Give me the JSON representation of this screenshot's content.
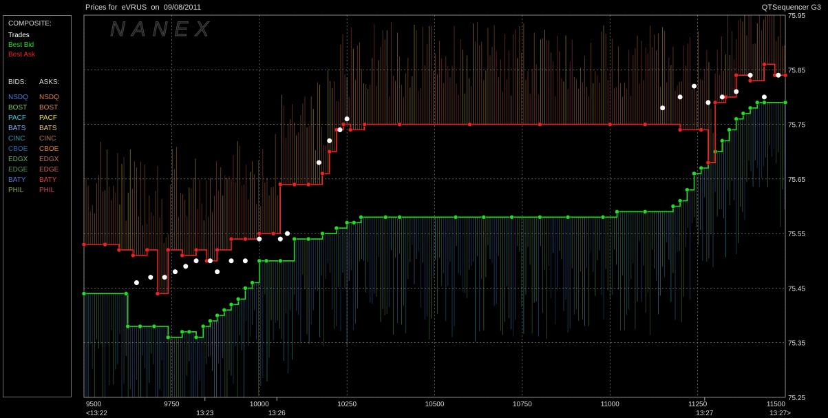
{
  "header": {
    "title": "Prices for  eVRUS  on  09/08/2011",
    "app_name": "QTSequencer G3"
  },
  "watermark": "NANEX",
  "legend": {
    "composite_label": "COMPOSITE:",
    "trades_label": "Trades",
    "best_bid_label": "Best Bid",
    "best_ask_label": "Best Ask",
    "bids_header": "BIDS:",
    "asks_header": "ASKS:",
    "exchanges": [
      {
        "name": "NSDQ",
        "bid_color": "#4a7fe0",
        "ask_color": "#e0823a"
      },
      {
        "name": "BOST",
        "bid_color": "#7fc85a",
        "ask_color": "#d98a5a"
      },
      {
        "name": "PACF",
        "bid_color": "#3fd0e0",
        "ask_color": "#f0e040"
      },
      {
        "name": "BATS",
        "bid_color": "#8ab4ff",
        "ask_color": "#f0d080"
      },
      {
        "name": "CINC",
        "bid_color": "#3a9ab0",
        "ask_color": "#b07840"
      },
      {
        "name": "CBOE",
        "bid_color": "#2a6ab0",
        "ask_color": "#e08020"
      },
      {
        "name": "EDGX",
        "bid_color": "#60b060",
        "ask_color": "#c07060"
      },
      {
        "name": "EDGE",
        "bid_color": "#5a9a5a",
        "ask_color": "#d06050"
      },
      {
        "name": "BATY",
        "bid_color": "#5a7ad0",
        "ask_color": "#e04040"
      },
      {
        "name": "PHIL",
        "bid_color": "#8aaa40",
        "ask_color": "#c05060"
      }
    ]
  },
  "colors": {
    "trade": "#ffffff",
    "best_bid": "#22dd22",
    "best_ask": "#ee2222",
    "grid": "#9a9a9a",
    "axis_text": "#dddddd"
  },
  "chart_data": {
    "type": "line",
    "title": "",
    "xlabel": "",
    "ylabel": "",
    "xlim": [
      9500,
      11500
    ],
    "ylim": [
      75.25,
      75.95
    ],
    "x_ticks": [
      {
        "value": 9500,
        "label": "9500",
        "time": "<13:22"
      },
      {
        "value": 9750,
        "label": "9750",
        "time": ""
      },
      {
        "value": 10000,
        "label": "10000",
        "time": ""
      },
      {
        "value": 10250,
        "label": "10250",
        "time": ""
      },
      {
        "value": 10500,
        "label": "10500",
        "time": ""
      },
      {
        "value": 10750,
        "label": "10750",
        "time": ""
      },
      {
        "value": 11000,
        "label": "11000",
        "time": ""
      },
      {
        "value": 11250,
        "label": "11250",
        "time": ""
      },
      {
        "value": 11500,
        "label": "11500",
        "time": "13:27>"
      }
    ],
    "time_marks": [
      {
        "value": 9845,
        "label": "13:23"
      },
      {
        "value": 10050,
        "label": "13:26"
      },
      {
        "value": 11270,
        "label": "13:27"
      }
    ],
    "y_ticks": [
      75.25,
      75.35,
      75.45,
      75.55,
      75.65,
      75.75,
      75.85,
      75.95
    ],
    "y_tick_labels": [
      "75.25",
      "75.35",
      "75.45",
      "75.55",
      "75.65",
      "75.75",
      "75.85",
      "75.95"
    ],
    "grid": true,
    "series": [
      {
        "name": "Best Bid",
        "color": "#22dd22",
        "points": [
          [
            9500,
            75.44
          ],
          [
            9620,
            75.44
          ],
          [
            9625,
            75.38
          ],
          [
            9660,
            75.38
          ],
          [
            9700,
            75.38
          ],
          [
            9740,
            75.36
          ],
          [
            9780,
            75.37
          ],
          [
            9800,
            75.37
          ],
          [
            9820,
            75.36
          ],
          [
            9840,
            75.38
          ],
          [
            9860,
            75.39
          ],
          [
            9880,
            75.4
          ],
          [
            9900,
            75.41
          ],
          [
            9920,
            75.42
          ],
          [
            9940,
            75.43
          ],
          [
            9960,
            75.45
          ],
          [
            9980,
            75.46
          ],
          [
            10000,
            75.5
          ],
          [
            10020,
            75.5
          ],
          [
            10060,
            75.5
          ],
          [
            10100,
            75.54
          ],
          [
            10140,
            75.54
          ],
          [
            10180,
            75.55
          ],
          [
            10220,
            75.56
          ],
          [
            10250,
            75.57
          ],
          [
            10270,
            75.57
          ],
          [
            10290,
            75.58
          ],
          [
            10360,
            75.58
          ],
          [
            10400,
            75.58
          ],
          [
            10560,
            75.58
          ],
          [
            10640,
            75.58
          ],
          [
            10720,
            75.58
          ],
          [
            10800,
            75.58
          ],
          [
            10880,
            75.58
          ],
          [
            10980,
            75.58
          ],
          [
            11020,
            75.59
          ],
          [
            11100,
            75.59
          ],
          [
            11180,
            75.6
          ],
          [
            11200,
            75.61
          ],
          [
            11220,
            75.63
          ],
          [
            11240,
            75.66
          ],
          [
            11260,
            75.67
          ],
          [
            11280,
            75.68
          ],
          [
            11300,
            75.7
          ],
          [
            11320,
            75.72
          ],
          [
            11340,
            75.74
          ],
          [
            11360,
            75.76
          ],
          [
            11380,
            75.77
          ],
          [
            11400,
            75.78
          ],
          [
            11420,
            75.79
          ],
          [
            11440,
            75.79
          ],
          [
            11500,
            75.79
          ]
        ]
      },
      {
        "name": "Best Ask",
        "color": "#ee2222",
        "points": [
          [
            9500,
            75.53
          ],
          [
            9560,
            75.53
          ],
          [
            9600,
            75.52
          ],
          [
            9640,
            75.51
          ],
          [
            9680,
            75.52
          ],
          [
            9710,
            75.44
          ],
          [
            9740,
            75.52
          ],
          [
            9780,
            75.51
          ],
          [
            9820,
            75.52
          ],
          [
            9850,
            75.5
          ],
          [
            9880,
            75.52
          ],
          [
            9920,
            75.54
          ],
          [
            9960,
            75.54
          ],
          [
            10000,
            75.55
          ],
          [
            10040,
            75.55
          ],
          [
            10060,
            75.64
          ],
          [
            10100,
            75.64
          ],
          [
            10140,
            75.64
          ],
          [
            10180,
            75.66
          ],
          [
            10200,
            75.7
          ],
          [
            10220,
            75.74
          ],
          [
            10240,
            75.75
          ],
          [
            10260,
            75.74
          ],
          [
            10300,
            75.75
          ],
          [
            10400,
            75.75
          ],
          [
            10600,
            75.75
          ],
          [
            10800,
            75.75
          ],
          [
            11000,
            75.75
          ],
          [
            11100,
            75.75
          ],
          [
            11200,
            75.74
          ],
          [
            11260,
            75.74
          ],
          [
            11280,
            75.68
          ],
          [
            11300,
            75.79
          ],
          [
            11330,
            75.8
          ],
          [
            11360,
            75.84
          ],
          [
            11400,
            75.83
          ],
          [
            11440,
            75.86
          ],
          [
            11470,
            75.84
          ],
          [
            11500,
            75.84
          ]
        ]
      },
      {
        "name": "Trades",
        "color": "#ffffff",
        "points": [
          [
            9650,
            75.46
          ],
          [
            9690,
            75.47
          ],
          [
            9730,
            75.47
          ],
          [
            9760,
            75.48
          ],
          [
            9790,
            75.49
          ],
          [
            9820,
            75.5
          ],
          [
            9860,
            75.5
          ],
          [
            9880,
            75.48
          ],
          [
            9920,
            75.5
          ],
          [
            9960,
            75.5
          ],
          [
            10000,
            75.54
          ],
          [
            10060,
            75.54
          ],
          [
            10080,
            75.55
          ],
          [
            10170,
            75.68
          ],
          [
            10200,
            75.72
          ],
          [
            10230,
            75.74
          ],
          [
            10250,
            75.76
          ],
          [
            11150,
            75.78
          ],
          [
            11200,
            75.8
          ],
          [
            11240,
            75.82
          ],
          [
            11280,
            75.79
          ],
          [
            11320,
            75.8
          ],
          [
            11360,
            75.81
          ],
          [
            11400,
            75.84
          ],
          [
            11440,
            75.8
          ],
          [
            11480,
            75.84
          ]
        ]
      }
    ]
  }
}
